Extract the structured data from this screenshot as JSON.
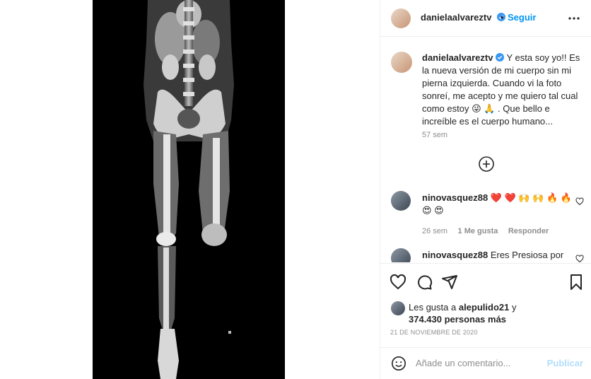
{
  "post": {
    "author": "danielaalvareztv",
    "follow_label": "Seguir",
    "more_icon": "more-horizontal-icon"
  },
  "caption": {
    "author": "danielaalvareztv",
    "text": "Y esta soy yo!! Es la nueva versión de mi cuerpo sin mi pierna izquierda. Cuando vi la foto sonreí, me acepto y me quiero tal cual como estoy 😜 🙏 . Que bello e increíble es el cuerpo humano...",
    "time": "57 sem"
  },
  "load_more_icon": "plus-circle-icon",
  "comments": [
    {
      "user": "ninovasquez88",
      "text": "❤️ ❤️ 🙌 🙌 🔥 🔥 😍 😍",
      "time": "26 sem",
      "likes": "1 Me gusta",
      "reply": "Responder"
    },
    {
      "user": "ninovasquez88",
      "text": "Eres Presiosa por",
      "time": "",
      "likes": "",
      "reply": ""
    }
  ],
  "actions": {
    "like_icon": "heart-icon",
    "comment_icon": "comment-icon",
    "share_icon": "send-icon",
    "save_icon": "bookmark-icon"
  },
  "likes": {
    "prefix": "Les gusta a",
    "user": "alepulido21",
    "connector": "y",
    "count": "374.430 personas más"
  },
  "date": "21 DE NOVIEMBRE DE 2020",
  "add_comment": {
    "placeholder": "Añade un comentario...",
    "publish": "Publicar",
    "emoji_icon": "emoji-icon"
  },
  "colors": {
    "accent": "#0095f6",
    "heart": "#ed4956",
    "publish_disabled": "#b2dffc"
  }
}
